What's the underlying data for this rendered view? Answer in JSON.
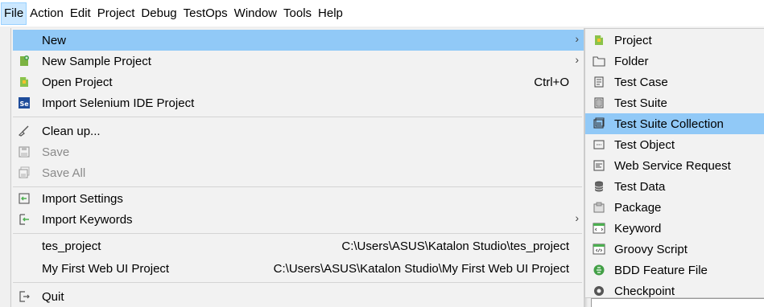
{
  "menubar": {
    "items": [
      "File",
      "Action",
      "Edit",
      "Project",
      "Debug",
      "TestOps",
      "Window",
      "Tools",
      "Help"
    ]
  },
  "file_menu": {
    "new": "New",
    "new_sample_project": "New Sample Project",
    "open_project": "Open Project",
    "open_project_shortcut": "Ctrl+O",
    "import_selenium": "Import Selenium IDE Project",
    "clean_up": "Clean up...",
    "save": "Save",
    "save_all": "Save All",
    "import_settings": "Import Settings",
    "import_keywords": "Import Keywords",
    "recent": [
      {
        "name": "tes_project",
        "path": "C:\\Users\\ASUS\\Katalon Studio\\tes_project"
      },
      {
        "name": "My First Web UI Project",
        "path": "C:\\Users\\ASUS\\Katalon Studio\\My First Web UI Project"
      }
    ],
    "quit": "Quit"
  },
  "new_submenu": {
    "items": [
      "Project",
      "Folder",
      "Test Case",
      "Test Suite",
      "Test Suite Collection",
      "Test Object",
      "Web Service Request",
      "Test Data",
      "Package",
      "Keyword",
      "Groovy Script",
      "BDD Feature File",
      "Checkpoint"
    ],
    "highlighted": "Test Suite Collection"
  },
  "colors": {
    "highlight": "#91c9f7",
    "menu_bg": "#f2f2f2",
    "disabled_text": "#8a8a8a"
  }
}
